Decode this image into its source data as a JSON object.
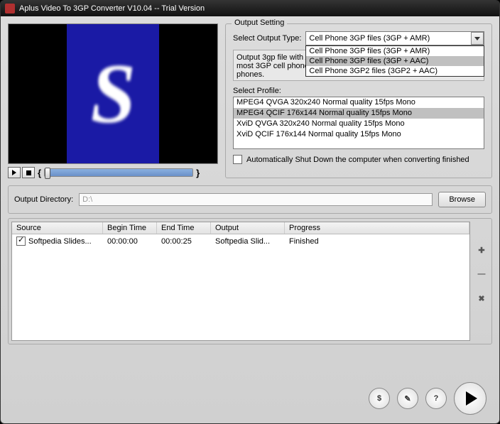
{
  "window": {
    "title": "Aplus Video To 3GP Converter V10.04 -- Trial Version"
  },
  "output_setting": {
    "legend": "Output Setting",
    "select_type_label": "Select Output Type:",
    "selected_type": "Cell Phone 3GP  files (3GP + AMR)",
    "type_options": [
      {
        "label": "Cell Phone 3GP  files (3GP + AMR)",
        "selected": false
      },
      {
        "label": "Cell Phone 3GP  files (3GP + AAC)",
        "selected": true
      },
      {
        "label": "Cell Phone 3GP2 files (3GP2 + AAC)",
        "selected": false
      }
    ],
    "description": "Output 3gp file with AMR audio (or AAC audio) format and played on most 3GP cell phones. But the audio quality may vary on different phones.",
    "select_profile_label": "Select Profile:",
    "profiles": [
      {
        "label": "MPEG4 QVGA 320x240 Normal quality 15fps Mono",
        "selected": false
      },
      {
        "label": "MPEG4 QCIF 176x144 Normal quality 15fps Mono",
        "selected": true
      },
      {
        "label": "XviD  QVGA 320x240 Normal quality 15fps Mono",
        "selected": false
      },
      {
        "label": "XviD  QCIF 176x144 Normal quality 15fps Mono",
        "selected": false
      }
    ],
    "auto_shutdown_label": "Automatically Shut Down the computer when converting finished"
  },
  "outdir": {
    "label": "Output Directory:",
    "value": "D:\\",
    "browse_label": "Browse"
  },
  "table": {
    "headers": {
      "source": "Source",
      "begin": "Begin Time",
      "end": "End Time",
      "output": "Output",
      "progress": "Progress"
    },
    "rows": [
      {
        "checked": true,
        "source": "Softpedia Slides...",
        "begin": "00:00:00",
        "end": "00:00:25",
        "output": "Softpedia Slid...",
        "progress": "Finished"
      }
    ]
  },
  "icons": {
    "plus": "✚",
    "minus": "—",
    "close": "✖",
    "dollar": "$",
    "key": "✎",
    "help": "?"
  },
  "preview": {
    "letter": "S"
  }
}
